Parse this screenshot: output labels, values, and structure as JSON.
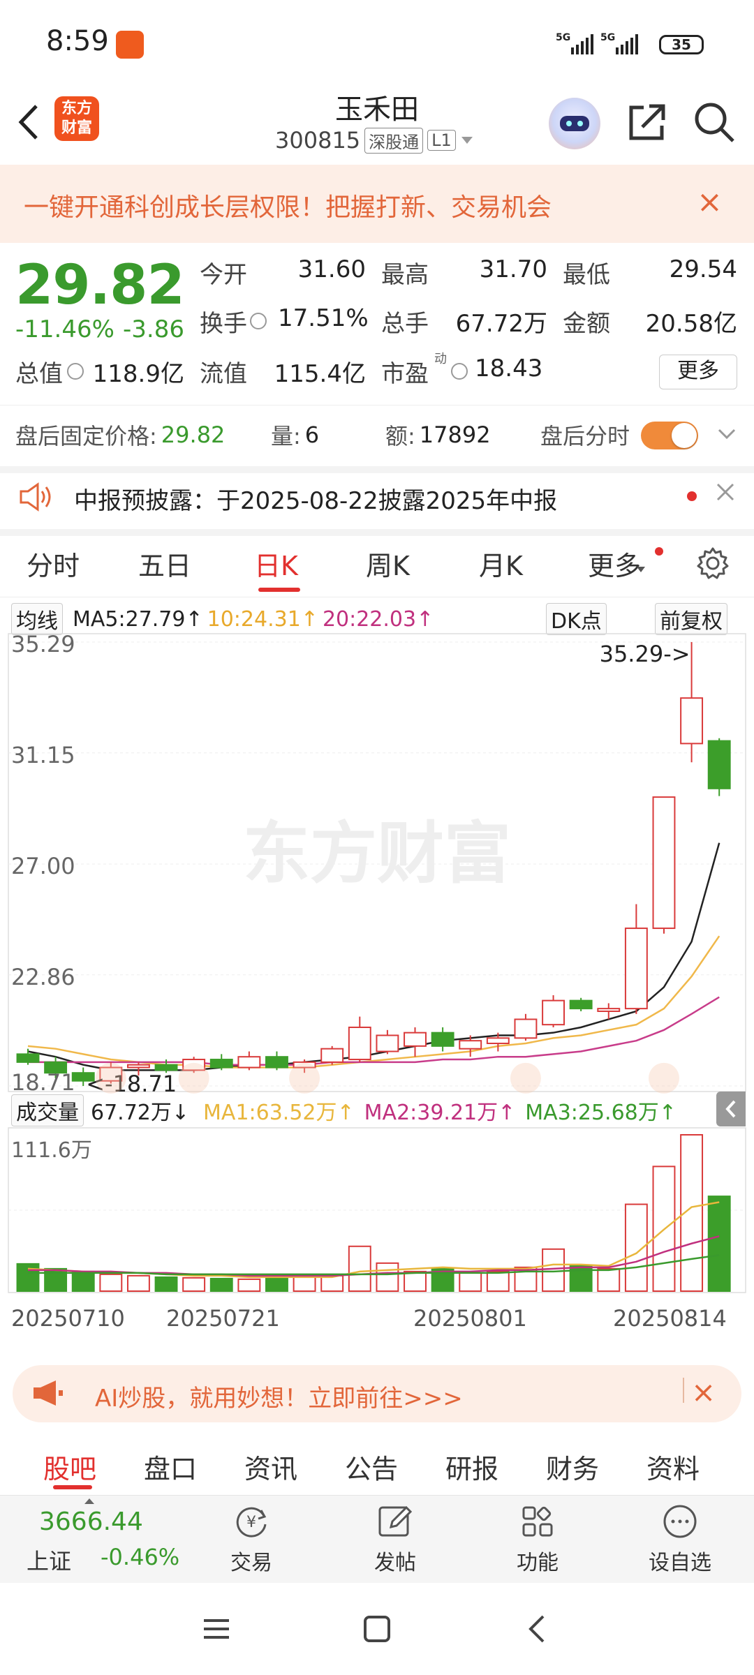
{
  "status_bar": {
    "time": "8:59",
    "signal": "5G 5G",
    "battery": "35"
  },
  "header": {
    "back": "‹",
    "logo_text": "东方财富",
    "stock_name": "玉禾田",
    "stock_code": "300815",
    "tag_connect": "深股通",
    "tag_level": "L1"
  },
  "banner": {
    "text": "一键开通科创成长层权限！把握打新、交易机会",
    "close": "×"
  },
  "quote": {
    "price": "29.82",
    "change_pct": "-11.46%",
    "change": "-3.86",
    "open_label": "今开",
    "open": "31.60",
    "high_label": "最高",
    "high": "31.70",
    "low_label": "最低",
    "low": "29.54",
    "turnover_label": "换手",
    "turnover": "17.51%",
    "volume_label": "总手",
    "volume": "67.72万",
    "amount_label": "金额",
    "amount": "20.58亿",
    "mktcap_label": "总值",
    "mktcap": "118.9亿",
    "float_label": "流值",
    "float": "115.4亿",
    "pe_label": "市盈",
    "pe_sup": "动",
    "pe": "18.43",
    "more": "更多"
  },
  "after_hours": {
    "price_label": "盘后固定价格:",
    "price": "29.82",
    "vol_label": "量:",
    "vol": "6",
    "amt_label": "额:",
    "amt": "17892",
    "timeshare_label": "盘后分时"
  },
  "notice": {
    "text": "中报预披露：于2025-08-22披露2025年中报"
  },
  "tabs": [
    "分时",
    "五日",
    "日K",
    "周K",
    "月K",
    "更多"
  ],
  "ma_legend": {
    "selector": "均线",
    "ma5": "MA5:27.79↑",
    "ma10": "10:24.31↑",
    "ma20": "20:22.03↑",
    "dk": "DK点",
    "adjust": "前复权"
  },
  "kchart": {
    "y_ticks": [
      "35.29",
      "31.15",
      "27.00",
      "22.86",
      "18.71"
    ],
    "high_annotation": "35.29->",
    "low_annotation": "<-18.71",
    "watermark": "东方财富"
  },
  "vol_legend": {
    "selector": "成交量",
    "vol": "67.72万↓",
    "ma1": "MA1:63.52万↑",
    "ma2": "MA2:39.21万↑",
    "ma3": "MA3:25.68万↑",
    "max": "111.6万"
  },
  "x_dates": [
    "20250710",
    "20250721",
    "20250801",
    "20250814"
  ],
  "chart_data": {
    "type": "candlestick",
    "y_range": [
      18.71,
      35.29
    ],
    "candles": [
      {
        "o": 19.9,
        "h": 20.1,
        "l": 19.5,
        "c": 19.6
      },
      {
        "o": 19.6,
        "h": 19.8,
        "l": 19.0,
        "c": 19.2
      },
      {
        "o": 19.2,
        "h": 19.4,
        "l": 18.71,
        "c": 18.9
      },
      {
        "o": 18.9,
        "h": 19.6,
        "l": 18.8,
        "c": 19.4
      },
      {
        "o": 19.4,
        "h": 19.6,
        "l": 19.1,
        "c": 19.5
      },
      {
        "o": 19.5,
        "h": 19.7,
        "l": 19.2,
        "c": 19.3
      },
      {
        "o": 19.3,
        "h": 19.8,
        "l": 19.2,
        "c": 19.7
      },
      {
        "o": 19.7,
        "h": 19.9,
        "l": 19.3,
        "c": 19.4
      },
      {
        "o": 19.4,
        "h": 20.0,
        "l": 19.3,
        "c": 19.8
      },
      {
        "o": 19.8,
        "h": 20.0,
        "l": 19.3,
        "c": 19.4
      },
      {
        "o": 19.4,
        "h": 19.7,
        "l": 19.2,
        "c": 19.6
      },
      {
        "o": 19.6,
        "h": 20.2,
        "l": 19.5,
        "c": 20.1
      },
      {
        "o": 19.7,
        "h": 21.3,
        "l": 19.6,
        "c": 20.9
      },
      {
        "o": 20.0,
        "h": 20.8,
        "l": 19.9,
        "c": 20.6
      },
      {
        "o": 20.2,
        "h": 20.9,
        "l": 19.8,
        "c": 20.7
      },
      {
        "o": 20.7,
        "h": 20.9,
        "l": 20.0,
        "c": 20.2
      },
      {
        "o": 20.1,
        "h": 20.6,
        "l": 19.8,
        "c": 20.4
      },
      {
        "o": 20.3,
        "h": 20.7,
        "l": 20.0,
        "c": 20.5
      },
      {
        "o": 20.5,
        "h": 21.4,
        "l": 20.4,
        "c": 21.2
      },
      {
        "o": 21.0,
        "h": 22.1,
        "l": 20.9,
        "c": 21.9
      },
      {
        "o": 21.9,
        "h": 22.0,
        "l": 21.5,
        "c": 21.6
      },
      {
        "o": 21.5,
        "h": 21.8,
        "l": 21.2,
        "c": 21.6
      },
      {
        "o": 21.6,
        "h": 25.5,
        "l": 21.4,
        "c": 24.6
      },
      {
        "o": 24.6,
        "h": 29.5,
        "l": 24.4,
        "c": 29.5
      },
      {
        "o": 31.5,
        "h": 35.29,
        "l": 30.8,
        "c": 33.2
      },
      {
        "o": 31.6,
        "h": 31.7,
        "l": 29.54,
        "c": 29.82
      }
    ],
    "volumes": [
      19.5,
      16,
      14,
      12,
      11,
      10,
      9.5,
      9,
      8.5,
      9.5,
      10,
      11,
      32,
      20,
      14,
      16,
      13,
      14,
      17,
      30,
      18,
      16,
      62,
      89,
      111.6,
      67.72
    ],
    "vol_max": 111.6,
    "ma5": [
      20.0,
      19.8,
      19.5,
      19.3,
      19.3,
      19.3,
      19.3,
      19.4,
      19.5,
      19.5,
      19.6,
      19.7,
      19.8,
      20.0,
      20.2,
      20.4,
      20.5,
      20.6,
      20.6,
      20.7,
      20.9,
      21.2,
      21.5,
      22.4,
      24.1,
      27.79
    ],
    "ma10": [
      20.2,
      20.1,
      19.9,
      19.7,
      19.6,
      19.5,
      19.5,
      19.4,
      19.4,
      19.4,
      19.4,
      19.5,
      19.6,
      19.7,
      19.8,
      19.9,
      20.0,
      20.2,
      20.3,
      20.5,
      20.6,
      20.8,
      21.0,
      21.6,
      22.8,
      24.31
    ],
    "ma20": [
      19.6,
      19.6,
      19.6,
      19.6,
      19.6,
      19.6,
      19.6,
      19.5,
      19.5,
      19.5,
      19.5,
      19.6,
      19.6,
      19.6,
      19.6,
      19.7,
      19.7,
      19.8,
      19.8,
      19.9,
      20.0,
      20.2,
      20.4,
      20.8,
      21.4,
      22.03
    ],
    "vol_ma1": [
      16,
      15,
      14,
      13,
      13,
      12,
      11,
      11,
      10,
      10,
      10,
      10,
      14,
      15,
      16,
      17,
      16,
      16,
      16,
      19,
      19,
      18,
      27,
      44,
      60,
      63.52
    ],
    "vol_ma2": [
      15,
      15,
      14,
      14,
      13,
      13,
      12,
      12,
      11,
      11,
      11,
      11,
      12,
      13,
      13,
      14,
      14,
      15,
      15,
      16,
      17,
      17,
      21,
      28,
      34,
      39.21
    ],
    "vol_ma3": [
      13,
      13,
      13,
      13,
      13,
      12,
      12,
      12,
      12,
      12,
      12,
      12,
      12,
      12,
      13,
      13,
      13,
      13,
      14,
      14,
      15,
      15,
      17,
      20,
      23,
      25.68
    ],
    "colors": {
      "up": "#d93a3a",
      "down": "#3c9e2a",
      "ma5": "#222222",
      "ma10": "#f0b84a",
      "ma20": "#c83c8a"
    }
  },
  "promo": {
    "text": "AI炒股，就用妙想！立即前往>>>",
    "close": "×"
  },
  "bottom_tabs": [
    "股吧",
    "盘口",
    "资讯",
    "公告",
    "研报",
    "财务",
    "资料"
  ],
  "footer": {
    "index_value": "3666.44",
    "index_name": "上证",
    "index_pct": "-0.46%",
    "items": [
      {
        "label": "交易",
        "icon": "trade-icon"
      },
      {
        "label": "发帖",
        "icon": "post-icon"
      },
      {
        "label": "功能",
        "icon": "function-icon"
      },
      {
        "label": "设自选",
        "icon": "add-watchlist-icon"
      }
    ]
  }
}
